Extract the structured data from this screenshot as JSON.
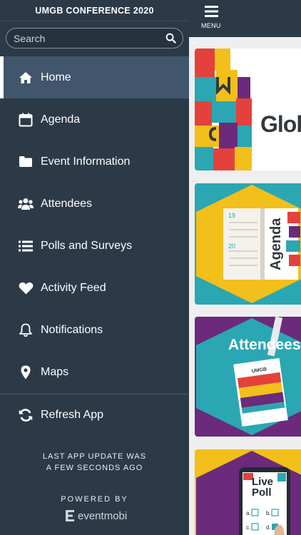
{
  "drawer": {
    "title": "UMGB CONFERENCE 2020",
    "search_placeholder": "Search",
    "items": [
      {
        "label": "Home",
        "icon": "home-icon",
        "active": true
      },
      {
        "label": "Agenda",
        "icon": "calendar-icon"
      },
      {
        "label": "Event Information",
        "icon": "folder-icon"
      },
      {
        "label": "Attendees",
        "icon": "people-icon"
      },
      {
        "label": "Polls and Surveys",
        "icon": "list-icon"
      },
      {
        "label": "Activity Feed",
        "icon": "heart-icon"
      },
      {
        "label": "Notifications",
        "icon": "bell-icon"
      },
      {
        "label": "Maps",
        "icon": "map-pin-icon"
      }
    ],
    "refresh_label": "Refresh App",
    "update_line1": "LAST APP UPDATE WAS",
    "update_line2": "A FEW SECONDS AGO",
    "powered_by": "POWERED BY",
    "brand": "eventmobi"
  },
  "topbar": {
    "menu_label": "MENU"
  },
  "tiles": [
    {
      "name": "home-banner",
      "text": "Glob"
    },
    {
      "name": "agenda-tile",
      "text": "Agenda",
      "dates": [
        "19",
        "20"
      ]
    },
    {
      "name": "attendees-tile",
      "text": "Attendees",
      "badge": "UMGB"
    },
    {
      "name": "live-poll-tile",
      "text": "Live Poll",
      "options": [
        "a.",
        "b.",
        "c.",
        "d."
      ]
    }
  ],
  "colors": {
    "drawer_bg": "#2c3a48",
    "active_bg": "#41566c",
    "teal": "#2aa7b2",
    "purple": "#6b2a7c",
    "yellow": "#f3bf1a",
    "red": "#e4413c"
  }
}
